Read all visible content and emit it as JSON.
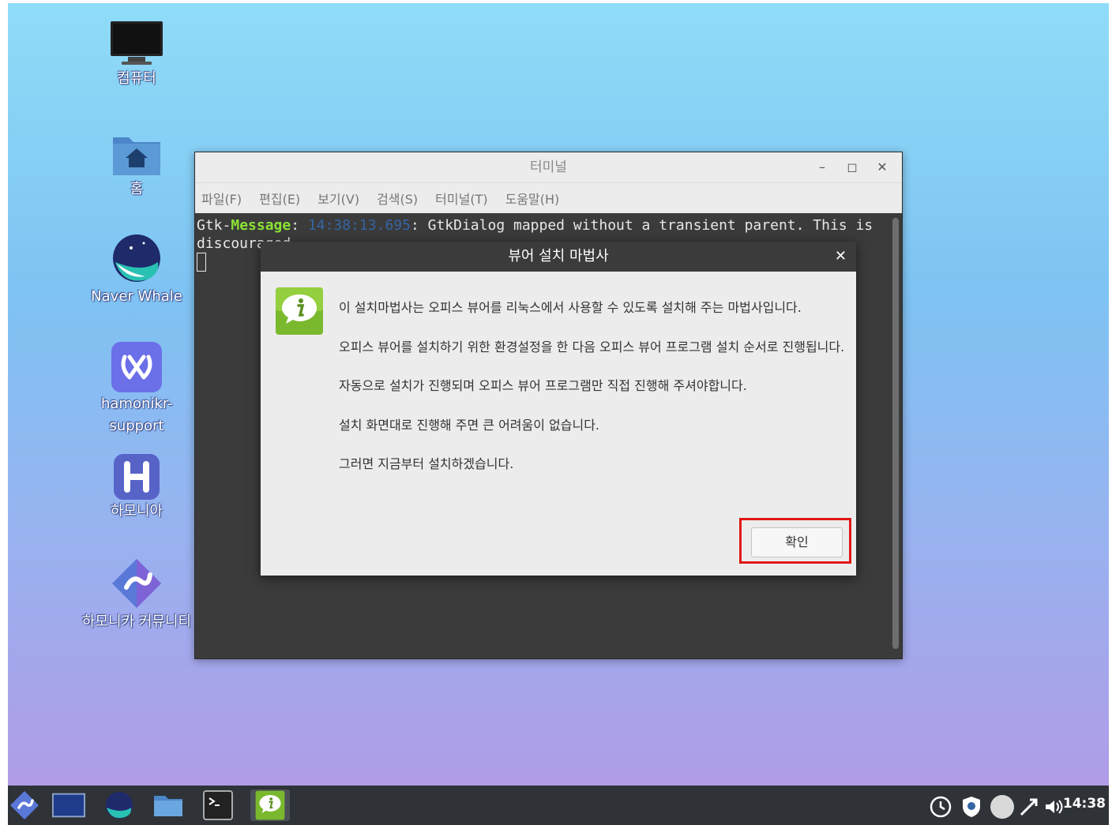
{
  "desktop": {
    "icons": [
      {
        "label": "컴퓨터",
        "icon": "computer-monitor-icon"
      },
      {
        "label": "홈",
        "icon": "home-folder-icon"
      },
      {
        "label": "Naver Whale",
        "icon": "naver-whale-icon"
      },
      {
        "label": "hamonikr-support",
        "icon": "hamonikr-support-icon"
      },
      {
        "label": "하모니아",
        "icon": "hamonia-icon"
      },
      {
        "label": "하모니카 커뮤니티",
        "icon": "hamonikr-community-icon"
      }
    ]
  },
  "terminal": {
    "title": "터미널",
    "menu": [
      "파일(F)",
      "편집(E)",
      "보기(V)",
      "검색(S)",
      "터미널(T)",
      "도움말(H)"
    ],
    "output": {
      "prefix": "Gtk-",
      "keyword": "Message",
      "colon": ": ",
      "timestamp": "14:38:13.695",
      "rest": ": GtkDialog mapped without a transient parent. This is",
      "line2": "discouraged."
    }
  },
  "dialog": {
    "title": "뷰어 설치 마법사",
    "lines": [
      "이 설치마법사는 오피스 뷰어를 리눅스에서 사용할 수 있도록 설치해 주는 마법사입니다.",
      "오피스 뷰어를 설치하기 위한 환경설정을 한 다음 오피스 뷰어 프로그램 설치 순서로 진행됩니다.",
      "자동으로 설치가 진행되며 오피스 뷰어 프로그램만 직접 진행해 주셔야합니다.",
      "설치 화면대로 진행해 주면 큰 어려움이 없습니다.",
      "그러면 지금부터 설치하겠습니다."
    ],
    "ok_label": "확인"
  },
  "taskbar": {
    "clock": "14:38"
  },
  "colors": {
    "highlight": "#e01818",
    "terminal_bg": "#3b3b3b",
    "message_green": "#8ae234"
  }
}
